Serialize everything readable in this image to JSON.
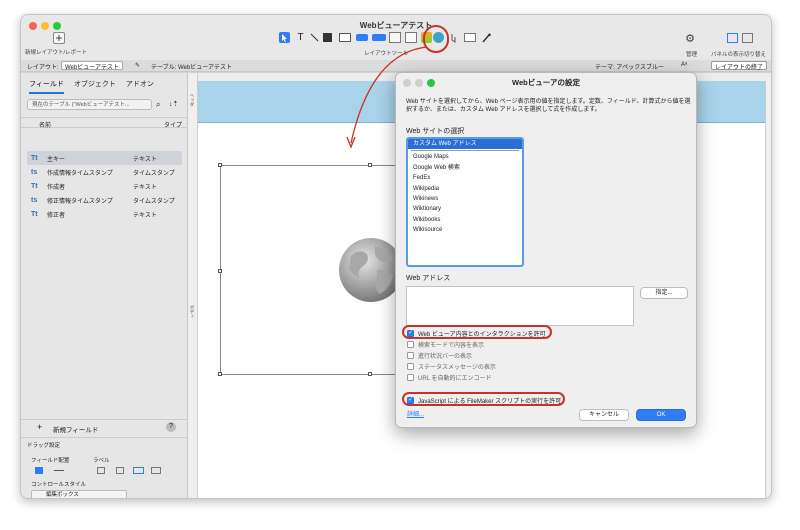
{
  "window": {
    "title": "Webビューアテスト"
  },
  "toolbar": {
    "left_label": "新規レイアウト/レポート",
    "center_label": "レイアウトツール",
    "manage_label": "管理",
    "panel_label": "パネルの表示切り替え"
  },
  "layoutbar": {
    "layout_prefix": "レイアウト:",
    "layout_value": "Webビューアテスト",
    "table_label": "テーブル: Webビューアテスト",
    "theme_label": "テーマ: アペックスブルー",
    "exit_button": "レイアウトの終了",
    "aa_label": "Aᵃ"
  },
  "sidebar": {
    "tabs": [
      "フィールド",
      "オブジェクト",
      "アドオン"
    ],
    "table_select": "現在のテーブル (\"Webビューアテスト...",
    "col_name": "名前",
    "col_type": "タイプ",
    "fields": [
      {
        "icon": "Tt",
        "name": "主キー",
        "type": "テキスト"
      },
      {
        "icon": "ts",
        "name": "作成情報タイムスタンプ",
        "type": "タイムスタンプ"
      },
      {
        "icon": "Tt",
        "name": "作成者",
        "type": "テキスト"
      },
      {
        "icon": "ts",
        "name": "修正情報タイムスタンプ",
        "type": "タイムスタンプ"
      },
      {
        "icon": "Tt",
        "name": "修正者",
        "type": "テキスト"
      }
    ],
    "new_field": "新規フィールド",
    "help": "?",
    "drag_settings": "ドラッグ設定",
    "field_placement": "フィールド配置",
    "label": "ラベル",
    "control_style": "コントロールスタイル",
    "control_value": "編集ボックス"
  },
  "canvas": {
    "ruler_top_label": "ヘッダ",
    "ruler_body_label": "ボディ"
  },
  "dialog": {
    "title": "Webビューアの設定",
    "description": "Web サイトを選択してから、Web ページ表示用の値を指定します。定数、フィールド、計算式から値を選択するか、または、カスタム Web アドレスを選択して式を作成します。",
    "site_heading": "Web サイトの選択",
    "sites": [
      "カスタム Web アドレス",
      "Google Maps",
      "Google Web 検索",
      "FedEx",
      "Wikipedia",
      "Wikinews",
      "Wiktionary",
      "Wikibooks",
      "Wikisource"
    ],
    "address_heading": "Web アドレス",
    "specify_button": "指定...",
    "options": [
      {
        "label": "Web ビューア内容とのインタラクションを許可",
        "checked": true
      },
      {
        "label": "検索モードで内容を表示",
        "checked": false
      },
      {
        "label": "進行状況バーの表示",
        "checked": false
      },
      {
        "label": "ステータスメッセージの表示",
        "checked": false
      },
      {
        "label": "URL を自動的にエンコード",
        "checked": false
      },
      {
        "label": "JavaScript による FileMaker スクリプトの実行を許可",
        "checked": true
      }
    ],
    "details_link": "詳細...",
    "cancel_button": "キャンセル",
    "ok_button": "OK"
  },
  "colors": {
    "accent": "#2e7cf6",
    "annotation": "#c8322a",
    "header_band": "#a9d3ea"
  }
}
